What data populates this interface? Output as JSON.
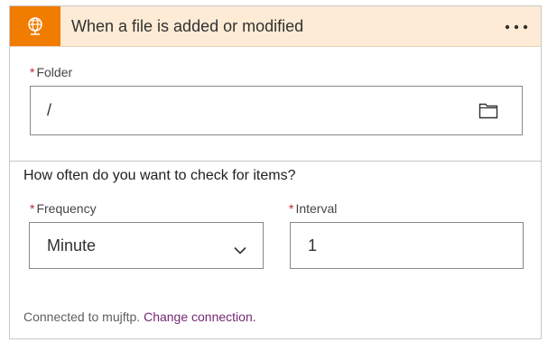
{
  "trigger": {
    "title": "When a file is added or modified",
    "icon": "ftp-globe-icon",
    "accent_color": "#f07c00",
    "header_bg": "#fdebd6",
    "more_icon": "more-options-icon"
  },
  "folder": {
    "required_mark": "*",
    "label": "Folder",
    "value": "/",
    "picker_icon": "folder-icon"
  },
  "recurrence": {
    "question": "How often do you want to check for items?",
    "frequency": {
      "required_mark": "*",
      "label": "Frequency",
      "value": "Minute",
      "dropdown_icon": "chevron-down-icon"
    },
    "interval": {
      "required_mark": "*",
      "label": "Interval",
      "value": "1"
    }
  },
  "connection": {
    "text": "Connected to mujftp.",
    "change_link": "Change connection."
  }
}
